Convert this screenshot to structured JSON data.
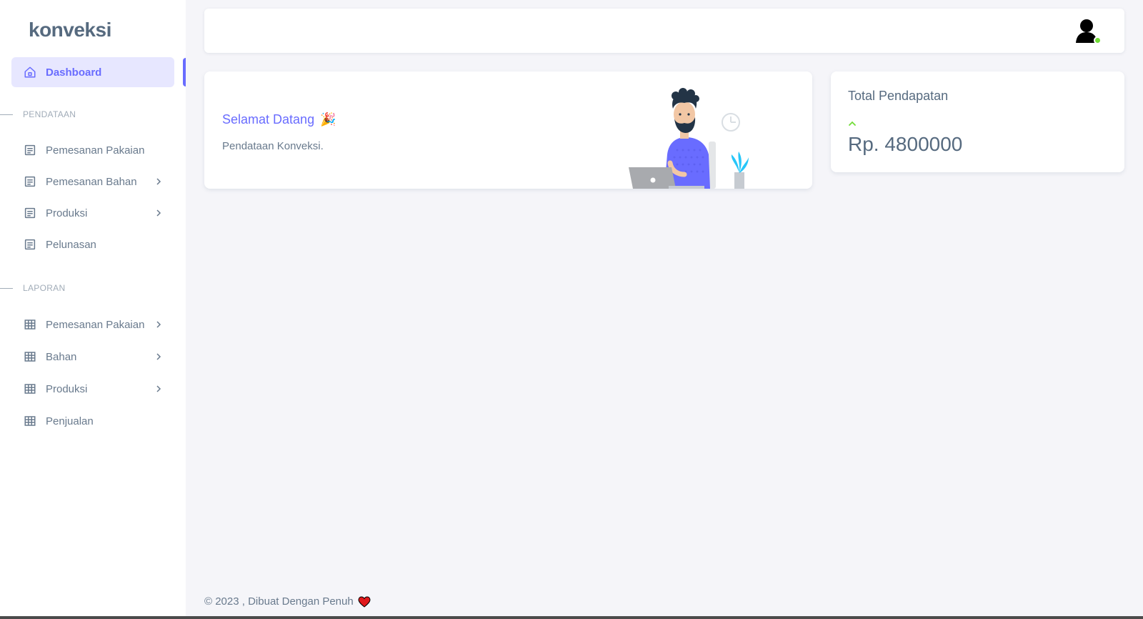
{
  "brand": "konveksi",
  "sidebar": {
    "dashboard": {
      "label": "Dashboard",
      "icon": "home-icon"
    },
    "sections": [
      {
        "header": "PENDATAAN",
        "items": [
          {
            "label": "Pemesanan Pakaian",
            "icon": "document-icon",
            "has_children": false
          },
          {
            "label": "Pemesanan Bahan",
            "icon": "document-icon",
            "has_children": true
          },
          {
            "label": "Produksi",
            "icon": "document-icon",
            "has_children": true
          },
          {
            "label": "Pelunasan",
            "icon": "document-icon",
            "has_children": false
          }
        ]
      },
      {
        "header": "LAPORAN",
        "items": [
          {
            "label": "Pemesanan Pakaian",
            "icon": "table-icon",
            "has_children": true
          },
          {
            "label": "Bahan",
            "icon": "table-icon",
            "has_children": true
          },
          {
            "label": "Produksi",
            "icon": "table-icon",
            "has_children": true
          },
          {
            "label": "Penjualan",
            "icon": "table-icon",
            "has_children": false
          }
        ]
      }
    ]
  },
  "welcome": {
    "title": "Selamat Datang",
    "emoji": "🎉",
    "subtitle": "Pendataan Konveksi."
  },
  "income": {
    "title": "Total Pendapatan",
    "trend_icon": "arrow-up-icon",
    "value": "Rp. 4800000"
  },
  "footer": {
    "text": "© 2023 , Dibuat Dengan Penuh",
    "heart": "❤"
  },
  "colors": {
    "primary": "#696cff",
    "active_bg": "#e7e7ff",
    "text": "#697a8d",
    "heading": "#566a7f",
    "success": "#71dd37",
    "background": "#f5f5f9"
  }
}
